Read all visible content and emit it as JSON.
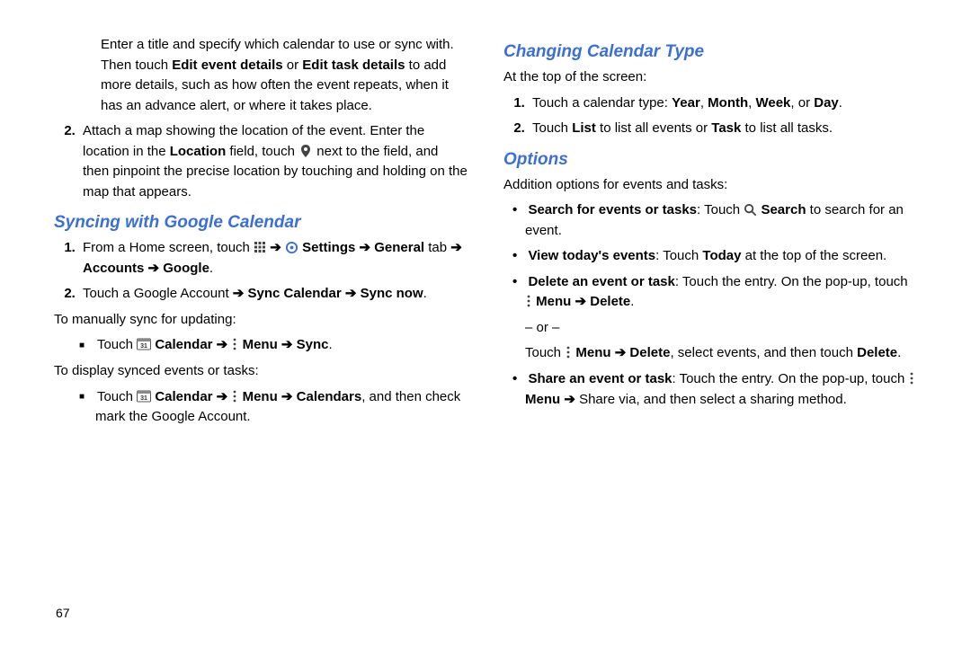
{
  "page_number": "67",
  "left": {
    "intro_items": [
      {
        "pre": "Enter a title and specify which calendar to use or sync with. Then touch ",
        "b1": "Edit event details",
        "mid1": " or ",
        "b2": "Edit task details",
        "post": " to add more details, such as how often the event repeats, when it has an advance alert, or where it takes place."
      },
      {
        "pre": "Attach a map showing the location of the event. Enter the location in the ",
        "b1": "Location",
        "mid1": " field, touch ",
        "icon": "map-pin-icon",
        "post": " next to the field, and then pinpoint the precise location by touching and holding on the map that appears."
      }
    ],
    "h_sync": "Syncing with Google Calendar",
    "sync_steps": [
      {
        "pre": "From a Home screen, touch ",
        "icon1": "apps-grid-icon",
        "arr1": " ➔ ",
        "icon2": "gear-icon",
        "seg1": " Settings ➔ General",
        "seg2": " tab ",
        "seg3": "➔ Accounts ➔ Google",
        "post": "."
      },
      {
        "pre": "Touch a Google Account ",
        "b1": "➔ Sync Calendar ➔ Sync now",
        "post": "."
      }
    ],
    "manual_sync_label": "To manually sync for updating:",
    "manual_sync_item": {
      "pre": "Touch ",
      "icon1": "calendar-31-icon",
      "b1": " Calendar ➔ ",
      "icon2": "menu-dots-icon",
      "b2": " Menu ➔ Sync",
      "post": "."
    },
    "display_label": "To display synced events or tasks:",
    "display_item": {
      "pre": "Touch ",
      "icon1": "calendar-31-icon",
      "b1": " Calendar ➔ ",
      "icon2": "menu-dots-icon",
      "b2": " Menu ➔ Calendars",
      "post": ", and then check mark the Google Account."
    }
  },
  "right": {
    "h_changing": "Changing Calendar Type",
    "changing_intro": "At the top of the screen:",
    "changing_steps": [
      {
        "pre": "Touch a calendar type: ",
        "b1": "Year",
        "c1": ", ",
        "b2": "Month",
        "c2": ", ",
        "b3": "Week",
        "c3": ", or ",
        "b4": "Day",
        "post": "."
      },
      {
        "pre": "Touch ",
        "b1": "List",
        "mid": " to list all events or ",
        "b2": "Task",
        "post": " to list all tasks."
      }
    ],
    "h_options": "Options",
    "options_intro": "Addition options for events and tasks:",
    "opt_search": {
      "b1": "Search for events or tasks",
      "mid": ": Touch ",
      "icon": "search-icon",
      "b2": " Search",
      "post": " to search for an event."
    },
    "opt_today": {
      "b1": "View today's events",
      "mid": ": Touch ",
      "b2": "Today",
      "post": " at the top of the screen."
    },
    "opt_delete": {
      "b1": "Delete an event or task",
      "mid": ": Touch the entry. On the pop-up, touch ",
      "icon": "menu-dots-icon",
      "b2": " Menu ➔ Delete",
      "post": "."
    },
    "or_label": "– or –",
    "opt_delete2": {
      "pre": "Touch ",
      "icon": "menu-dots-icon",
      "b1": " Menu ➔ Delete",
      "mid": ", select events, and then touch ",
      "b2": "Delete",
      "post": "."
    },
    "opt_share": {
      "b1": "Share an event or task",
      "mid": ": Touch the entry. On the pop-up, touch ",
      "icon": "menu-dots-icon",
      "b2": " Menu ➔",
      "post": " Share via, and then select a sharing method."
    }
  }
}
